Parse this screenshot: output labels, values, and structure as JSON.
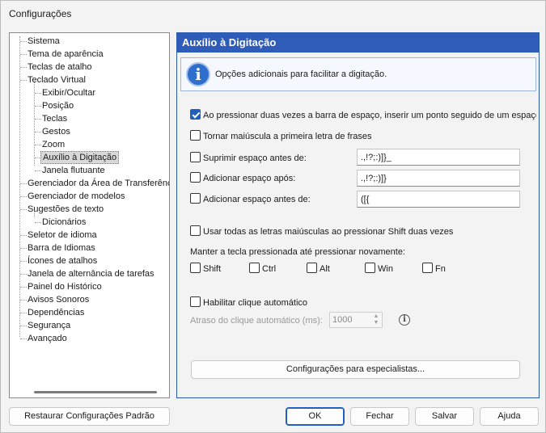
{
  "window": {
    "title": "Configurações"
  },
  "tree": {
    "items": [
      {
        "label": "Sistema",
        "level": 0
      },
      {
        "label": "Tema de aparência",
        "level": 0
      },
      {
        "label": "Teclas de atalho",
        "level": 0
      },
      {
        "label": "Teclado Virtual",
        "level": 0
      },
      {
        "label": "Exibir/Ocultar",
        "level": 1
      },
      {
        "label": "Posição",
        "level": 1
      },
      {
        "label": "Teclas",
        "level": 1
      },
      {
        "label": "Gestos",
        "level": 1
      },
      {
        "label": "Zoom",
        "level": 1
      },
      {
        "label": "Auxílio à Digitação",
        "level": 1,
        "selected": true
      },
      {
        "label": "Janela flutuante",
        "level": 1
      },
      {
        "label": "Gerenciador da Área de Transferência",
        "level": 0
      },
      {
        "label": "Gerenciador de modelos",
        "level": 0
      },
      {
        "label": "Sugestões de texto",
        "level": 0
      },
      {
        "label": "Dicionários",
        "level": 1
      },
      {
        "label": "Seletor de idioma",
        "level": 0
      },
      {
        "label": "Barra de Idiomas",
        "level": 0
      },
      {
        "label": "Ícones de atalhos",
        "level": 0
      },
      {
        "label": "Janela de alternância de tarefas",
        "level": 0
      },
      {
        "label": "Painel do Histórico",
        "level": 0
      },
      {
        "label": "Avisos Sonoros",
        "level": 0
      },
      {
        "label": "Dependências",
        "level": 0
      },
      {
        "label": "Segurança",
        "level": 0
      },
      {
        "label": "Avançado",
        "level": 0
      }
    ]
  },
  "panel": {
    "header": "Auxílio à Digitação",
    "info_text": "Opções adicionais para facilitar a digitação.",
    "opt_double_space": {
      "label": "Ao pressionar duas vezes a barra de espaço, inserir um ponto seguido de um espaço",
      "checked": true
    },
    "opt_capitalize": {
      "label": "Tornar maiúscula a primeira letra de frases",
      "checked": false
    },
    "opt_suppress_space": {
      "label": "Suprimir espaço antes de:",
      "checked": false,
      "value": ".,!?;:)]}_"
    },
    "opt_add_after": {
      "label": "Adicionar espaço após:",
      "checked": false,
      "value": ".,!?;:)]}"
    },
    "opt_add_before": {
      "label": "Adicionar espaço antes de:",
      "checked": false,
      "value": "([{"
    },
    "opt_shift_caps": {
      "label": "Usar todas as letras maiúsculas ao pressionar Shift duas vezes",
      "checked": false
    },
    "hold_label": "Manter a tecla pressionada até pressionar novamente:",
    "hold_keys": [
      {
        "label": "Shift",
        "checked": false
      },
      {
        "label": "Ctrl",
        "checked": false
      },
      {
        "label": "Alt",
        "checked": false
      },
      {
        "label": "Win",
        "checked": false
      },
      {
        "label": "Fn",
        "checked": false
      }
    ],
    "opt_autoclick": {
      "label": "Habilitar clique automático",
      "checked": false
    },
    "autoclick_delay_label": "Atraso do clique automático (ms):",
    "autoclick_delay_value": "1000",
    "expert_button": "Configurações para especialistas..."
  },
  "footer": {
    "restore": "Restaurar Configurações Padrão",
    "ok": "OK",
    "close": "Fechar",
    "save": "Salvar",
    "help": "Ajuda"
  }
}
